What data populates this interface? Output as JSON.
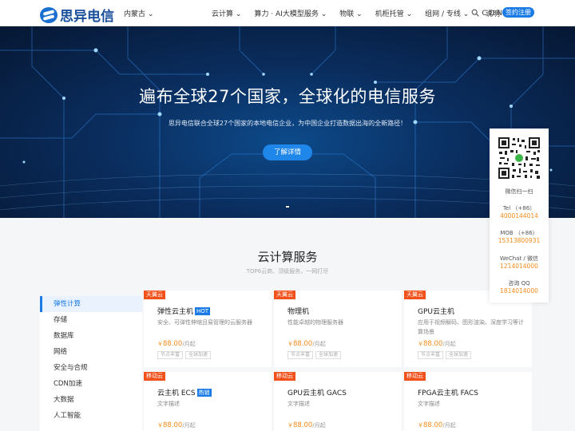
{
  "header": {
    "brand": "思异电信",
    "region": "内蒙古",
    "nav": [
      "云计算",
      "算力 · AI大模型服务",
      "物联",
      "机柜托管",
      "组网 / 专线",
      "C D N"
    ],
    "explain": "说明",
    "signup": "签约注册"
  },
  "hero": {
    "title": "遍布全球27个国家，全球化的电信服务",
    "subtitle": "思异电信联合全球27个国家的本地电信企业，为中国企业打造数据出海的全新路径！",
    "button": "了解详情"
  },
  "section": {
    "title": "云计算服务",
    "subtitle": "TOP6云商、顶级服务，一网打尽"
  },
  "sidebar": [
    "弹性计算",
    "存储",
    "数据库",
    "网络",
    "安全与合规",
    "CDN加速",
    "大数据",
    "人工智能"
  ],
  "cards": [
    {
      "tag": "天翼云",
      "title": "弹性云主机",
      "badge": "HOT",
      "desc": "安全、可弹性伸缩且易管理的云服务器",
      "currency": "￥",
      "price": "88.00",
      "unit": "/月起",
      "chips": [
        "节点丰富",
        "全球加速"
      ]
    },
    {
      "tag": "天翼云",
      "title": "物理机",
      "badge": "",
      "desc": "性能卓越的物理服务器",
      "currency": "￥",
      "price": "88.00",
      "unit": "/月起",
      "chips": [
        "节点丰富",
        "全球加速"
      ]
    },
    {
      "tag": "天翼云",
      "title": "GPU云主机",
      "badge": "",
      "desc": "应用于视频解码、图形渲染、深度学习等计算场景",
      "currency": "￥",
      "price": "88.00",
      "unit": "/月起",
      "chips": [
        "节点丰富",
        "全球加速"
      ]
    },
    {
      "tag": "移动云",
      "title": "云主机 ECS",
      "badge": "热销",
      "desc": "文字描述",
      "currency": "￥",
      "price": "88.00",
      "unit": "/月起",
      "chips": []
    },
    {
      "tag": "移动云",
      "title": "GPU云主机 GACS",
      "badge": "",
      "desc": "文字描述",
      "currency": "￥",
      "price": "88.00",
      "unit": "/月起",
      "chips": []
    },
    {
      "tag": "移动云",
      "title": "FPGA云主机 FACS",
      "badge": "",
      "desc": "文字描述",
      "currency": "￥",
      "price": "88.00",
      "unit": "/月起",
      "chips": []
    }
  ],
  "contact": {
    "scan": "微信扫一扫",
    "tel_label": "Tel （+86）",
    "tel": "4000144014",
    "mob_label": "MOB （+86）",
    "mob": "15313800931",
    "wechat_label": "WeChat / 微信",
    "wechat": "1214014000",
    "qq_label": "咨询 QQ",
    "qq": "1814014000"
  },
  "colors": {
    "brand": "#1a7be6",
    "tag": "#f2511b",
    "price": "#f58c1b"
  }
}
